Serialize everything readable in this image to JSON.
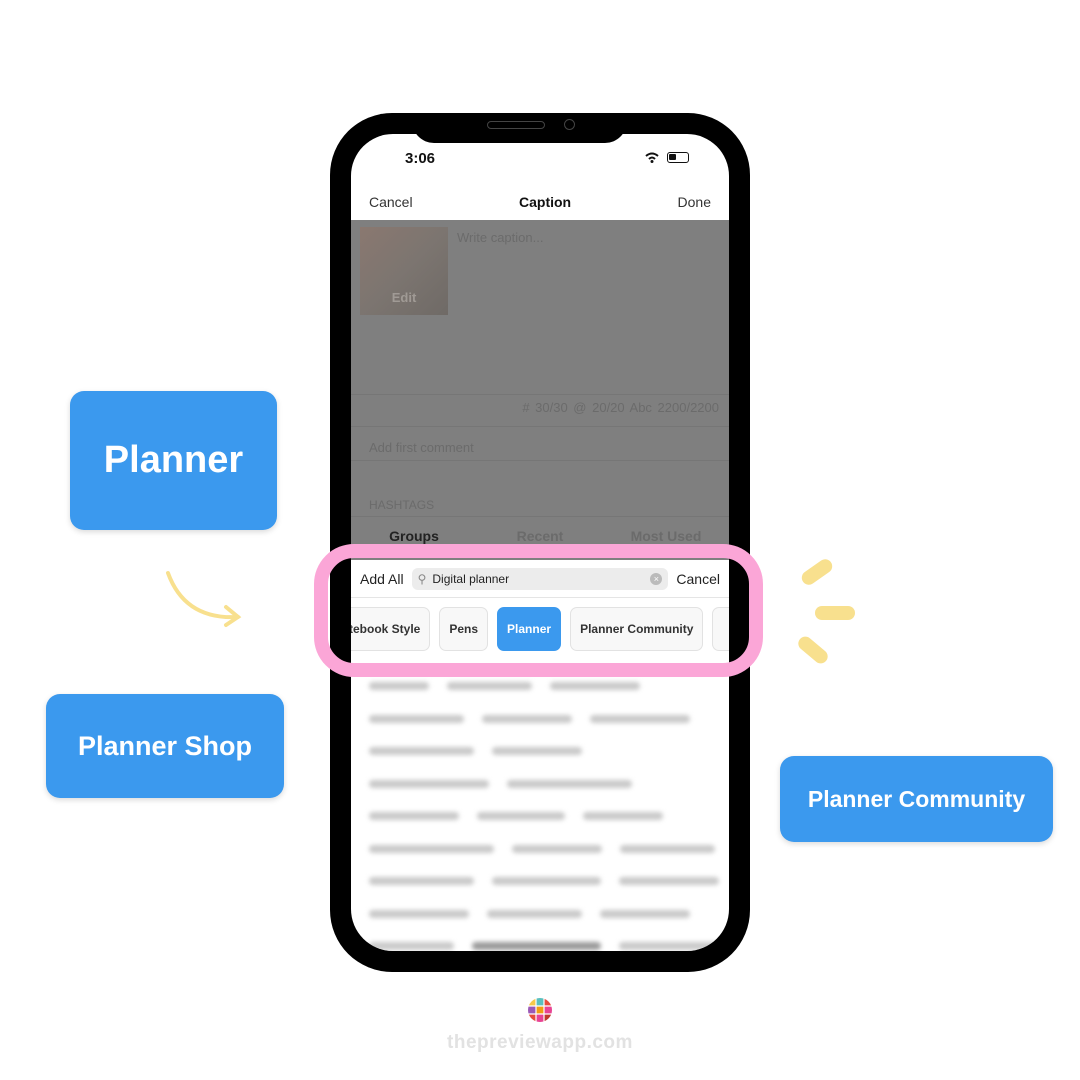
{
  "callouts": {
    "planner": "Planner",
    "planner_shop": "Planner Shop",
    "planner_community": "Planner Community"
  },
  "status_bar": {
    "time": "3:06"
  },
  "nav": {
    "cancel": "Cancel",
    "title": "Caption",
    "done": "Done"
  },
  "caption": {
    "placeholder": "Write caption...",
    "edit_label": "Edit",
    "counts": "# 30/30   @ 20/20   Abc 2200/2200",
    "first_comment_placeholder": "Add first comment"
  },
  "hashtags": {
    "section_label": "HASHTAGS",
    "tabs": [
      "Groups",
      "Recent",
      "Most Used"
    ],
    "active_tab": "Groups"
  },
  "search": {
    "add_all": "Add All",
    "value": "Digital planner",
    "cancel": "Cancel"
  },
  "chips": [
    {
      "label": "tebook Style"
    },
    {
      "label": "Pens"
    },
    {
      "label": "Planner",
      "active": true
    },
    {
      "label": "Planner Community"
    },
    {
      "label": ""
    }
  ],
  "footer": {
    "site": "thepreviewapp.com"
  },
  "colors": {
    "accent": "#3b99ee",
    "highlight": "#fba6d7",
    "doodle": "#f8e08e"
  }
}
